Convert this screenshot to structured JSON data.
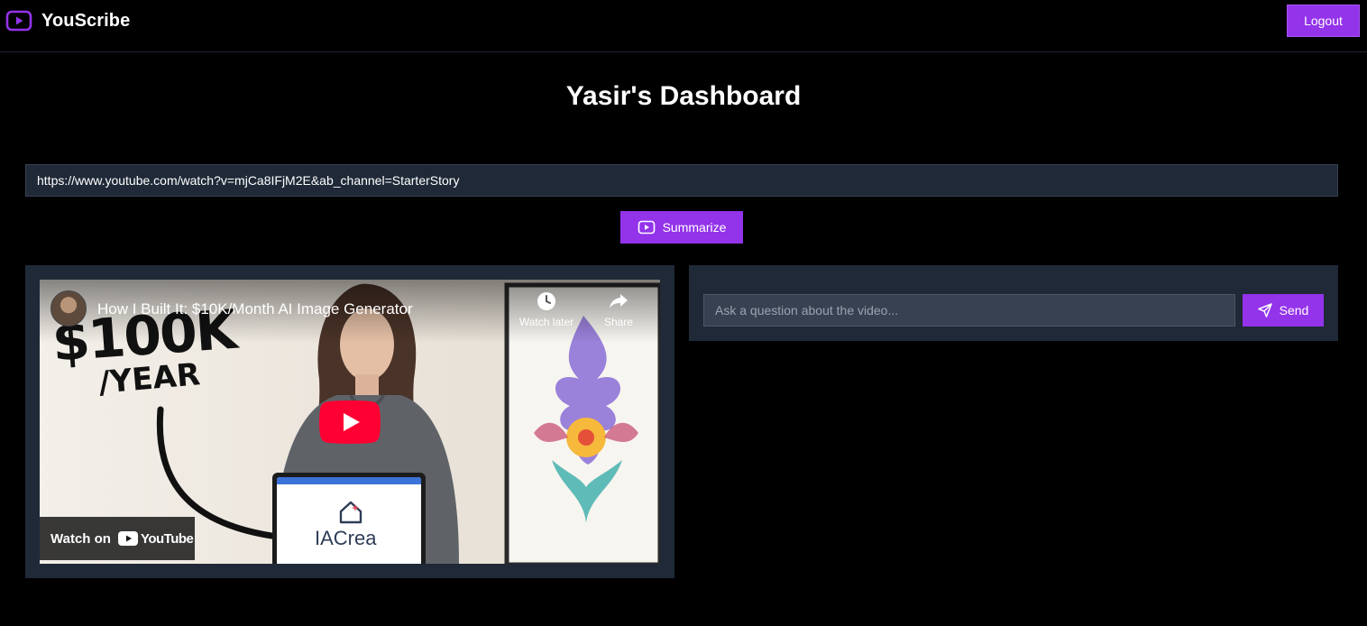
{
  "app": {
    "name": "YouScribe",
    "logout_label": "Logout",
    "accent_color": "#9333ea"
  },
  "dashboard": {
    "title": "Yasir's Dashboard"
  },
  "url_form": {
    "value": "https://www.youtube.com/watch?v=mjCa8IFjM2E&ab_channel=StarterStory",
    "submit_label": "Summarize",
    "submit_icon": "video-play-icon"
  },
  "video": {
    "title": "How I Built It: $10K/Month AI Image Generator",
    "watch_later_label": "Watch later",
    "share_label": "Share",
    "watch_on_label": "Watch on",
    "youtube_label": "YouTube",
    "thumbnail_big_text": "$100K",
    "thumbnail_sub_text": "/YEAR",
    "laptop_logo_text": "IACrea"
  },
  "chat": {
    "placeholder": "Ask a question about the video...",
    "send_label": "Send",
    "send_icon": "paper-plane-icon"
  }
}
